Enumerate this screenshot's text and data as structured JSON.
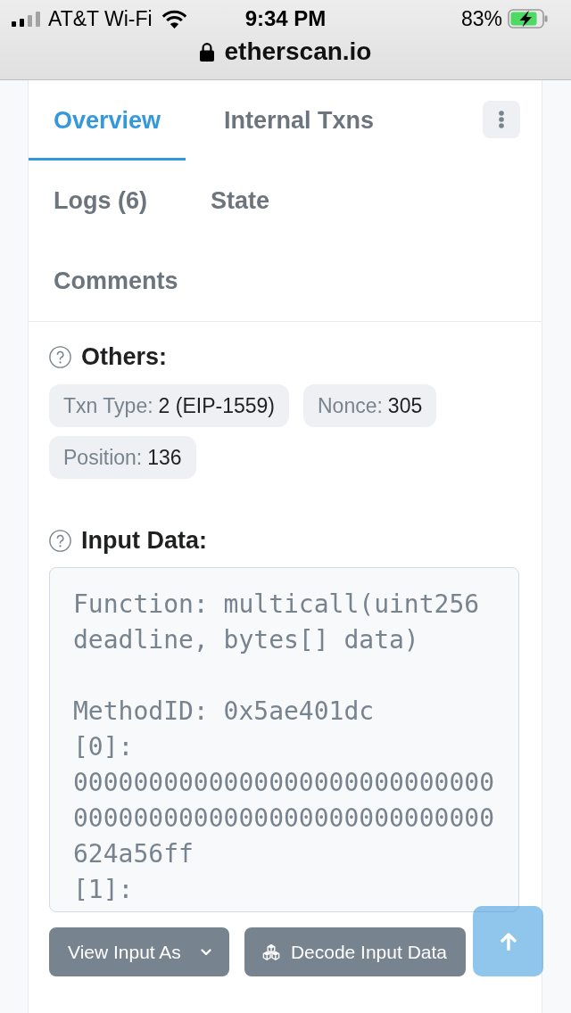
{
  "status_bar": {
    "carrier": "AT&T Wi-Fi",
    "time": "9:34 PM",
    "battery": "83%"
  },
  "address_bar": {
    "url": "etherscan.io"
  },
  "tabs": [
    {
      "label": "Overview",
      "selected": true
    },
    {
      "label": "Internal Txns",
      "selected": false
    },
    {
      "label": "Logs (6)",
      "selected": false
    },
    {
      "label": "State",
      "selected": false
    },
    {
      "label": "Comments",
      "selected": false
    }
  ],
  "others": {
    "title": "Others:",
    "badges": [
      {
        "label": "Txn Type:",
        "value": "2 (EIP-1559)"
      },
      {
        "label": "Nonce:",
        "value": "305"
      },
      {
        "label": "Position:",
        "value": "136"
      }
    ]
  },
  "input_data": {
    "title": "Input Data:",
    "text": "Function: multicall(uint256 deadline, bytes[] data)\n\nMethodID: 0x5ae401dc\n[0]:\n00000000000000000000000000000000000000000000000000000000624a56ff\n[1]:",
    "buttons": [
      {
        "label": "View Input As",
        "kind": "dropdown"
      },
      {
        "label": "Decode Input Data",
        "kind": "decode"
      }
    ]
  }
}
